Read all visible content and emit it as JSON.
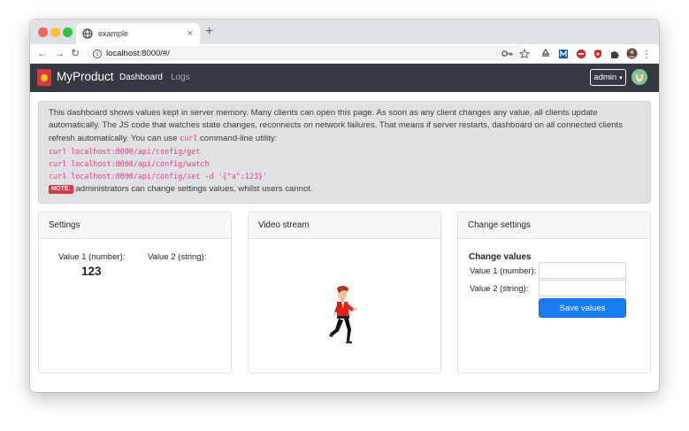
{
  "browser": {
    "tab_title": "example",
    "tab_close": "×",
    "new_tab": "+",
    "url": "localhost:8000/#/",
    "back": "←",
    "forward": "→",
    "reload": "↻",
    "info_glyph": "i",
    "menu": "⋮"
  },
  "navbar": {
    "brand": "MyProduct",
    "links": [
      "Dashboard",
      "Logs"
    ],
    "user_button": "admin",
    "caret": "▾"
  },
  "info": {
    "intro": "This dashboard shows values kept in server memory. Many clients can open this page. As soon as any client changes any value, all clients update automatically. The JS code that watches state changes, reconnects on network failures. That means if server restarts, dashboard on all connected clients refresh automatically. You can use",
    "curl_word": "curl",
    "intro_tail": "command-line utility:",
    "commands": [
      "curl localhost:8000/api/config/get",
      "curl localhost:8000/api/config/watch",
      "curl localhost:8000/api/config/set -d '{\"a\":123}'"
    ],
    "note_badge": "NOTE:",
    "note_text": "administrators can change settings values, whilst users cannot."
  },
  "settings_card": {
    "header": "Settings",
    "value1_label": "Value 1 (number):",
    "value1": "123",
    "value2_label": "Value 2 (string):",
    "value2": ""
  },
  "video_card": {
    "header": "Video stream"
  },
  "change_card": {
    "header": "Change settings",
    "title": "Change values",
    "value1_label": "Value 1 (number):",
    "value2_label": "Value 2 (string):",
    "value1_input": "",
    "value2_input": "",
    "save_button": "Save values"
  },
  "colors": {
    "navbar": "#343a40",
    "primary": "#1a7cf6",
    "code": "#e83e8c",
    "badge": "#dc3545"
  }
}
